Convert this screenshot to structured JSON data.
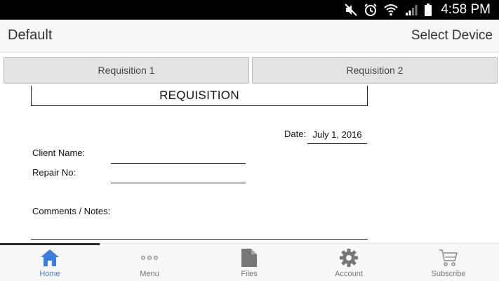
{
  "status_bar": {
    "time": "4:58 PM",
    "icons": [
      "mute-icon",
      "alarm-icon",
      "wifi-icon",
      "signal-icon",
      "battery-icon"
    ]
  },
  "header": {
    "title": "Default",
    "select_device": "Select Device"
  },
  "tabs": [
    {
      "label": "Requisition 1"
    },
    {
      "label": "Requisition 2"
    }
  ],
  "document": {
    "title": "REQUISITION",
    "date_label": "Date:",
    "date_value": "July 1, 2016",
    "client_name_label": "Client Name:",
    "repair_no_label": "Repair No:",
    "comments_label": "Comments / Notes:"
  },
  "bottom_nav": {
    "active": "Home",
    "items": [
      {
        "label": "Home",
        "icon": "home-icon"
      },
      {
        "label": "Menu",
        "icon": "more-dots-icon"
      },
      {
        "label": "Files",
        "icon": "file-icon"
      },
      {
        "label": "Account",
        "icon": "gear-icon"
      },
      {
        "label": "Subscribe",
        "icon": "cart-icon"
      }
    ]
  },
  "colors": {
    "accent": "#3b7de0",
    "status_bar": "#000000",
    "tab_background": "#e3e3e3"
  }
}
